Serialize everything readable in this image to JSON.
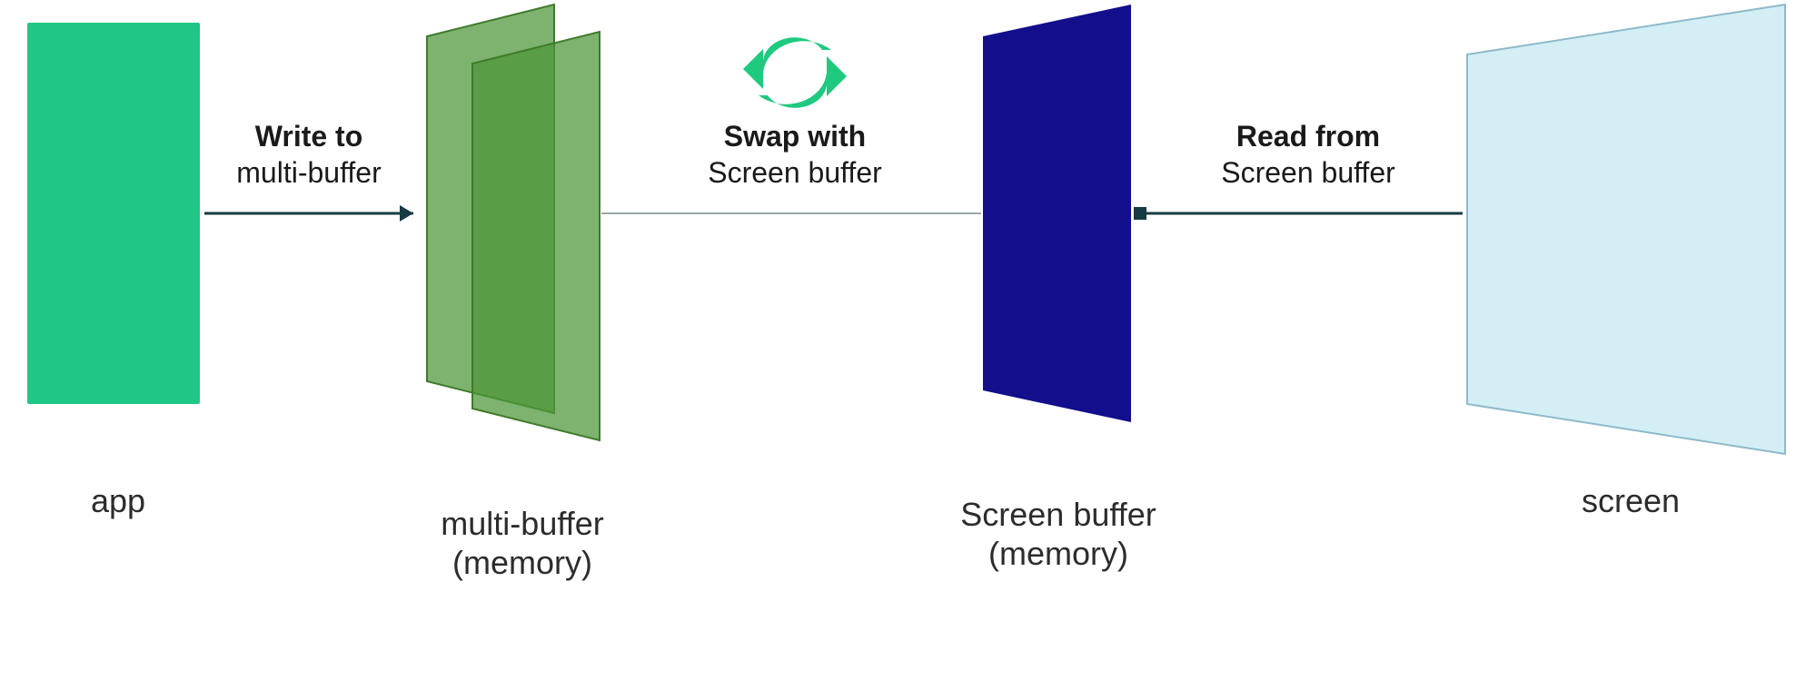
{
  "colors": {
    "app": "#1ec884",
    "multibuffer_fill": "rgba(75,150,55,0.72)",
    "multibuffer_stroke": "#3f7a2a",
    "screenbuffer": "#120e8c",
    "screen_fill": "#d4eef6",
    "screen_stroke": "#8ebac9",
    "arrow": "#163b44",
    "swap_icon": "#1fc97f"
  },
  "nodes": {
    "app_label": "app",
    "multibuffer_label_l1": "multi-buffer",
    "multibuffer_label_l2": "(memory)",
    "screenbuffer_label_l1": "Screen buffer",
    "screenbuffer_label_l2": "(memory)",
    "screen_label": "screen"
  },
  "edges": {
    "write": {
      "bold": "Write to",
      "rest": "multi-buffer"
    },
    "swap": {
      "bold": "Swap with",
      "rest": "Screen buffer"
    },
    "read": {
      "bold": "Read from",
      "rest": "Screen buffer"
    }
  }
}
